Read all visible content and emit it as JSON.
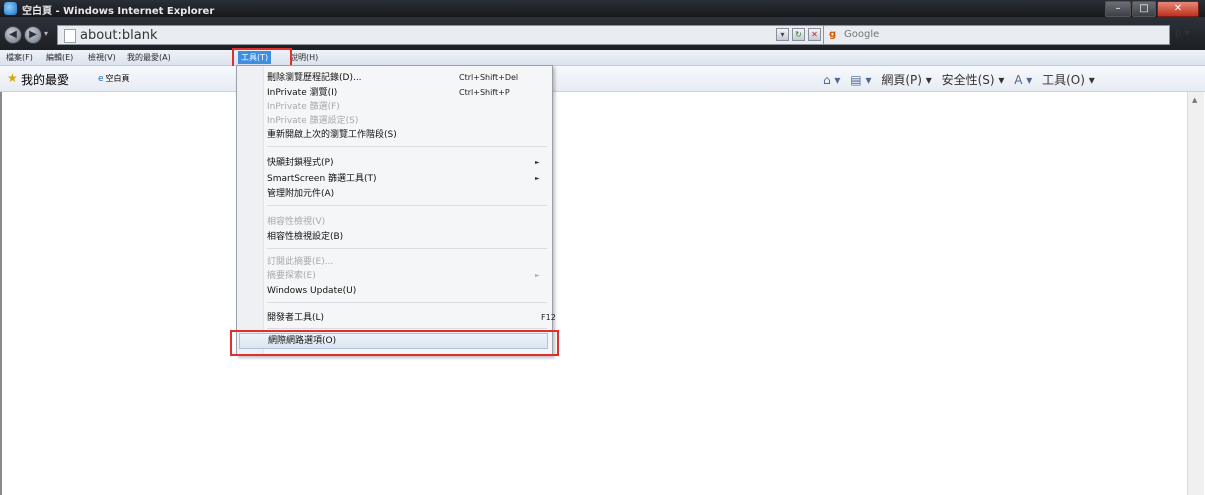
{
  "window": {
    "title": "空白頁 - Windows Internet Explorer",
    "controls": {
      "minimize": "–",
      "maximize": "□",
      "close": "✕"
    }
  },
  "navigation": {
    "back_icon": "back-arrow-icon",
    "forward_icon": "forward-arrow-icon",
    "dropdown": "▾"
  },
  "address": {
    "url": "about:blank",
    "dropdown": "▾",
    "refresh": "↻",
    "stop": "✕"
  },
  "search": {
    "provider_icon": "google-icon",
    "provider_glyph": "g",
    "placeholder": "Google",
    "go": "ρ ▾"
  },
  "menubar": {
    "items": [
      {
        "label": "檔案(F)"
      },
      {
        "label": "編輯(E)"
      },
      {
        "label": "檢視(V)"
      },
      {
        "label": "我的最愛(A)"
      },
      {
        "label": "工具(T)",
        "active": true
      },
      {
        "label": "說明(H)"
      }
    ]
  },
  "favorites": {
    "label": "我的最愛",
    "tab": "空白頁"
  },
  "command_bar": {
    "home": "⌂ ▾",
    "feeds": "▤ ▾",
    "page": "網頁(P) ▾",
    "safety": "安全性(S) ▾",
    "text_size": "A ▾",
    "tools": "工具(O) ▾"
  },
  "tools_menu": {
    "items": [
      {
        "label": "刪除瀏覽歷程記錄(D)...",
        "shortcut": "Ctrl+Shift+Del"
      },
      {
        "label": "InPrivate 瀏覽(I)",
        "shortcut": "Ctrl+Shift+P"
      },
      {
        "label": "InPrivate 篩選(F)",
        "disabled": true
      },
      {
        "label": "InPrivate 篩選設定(S)",
        "disabled": true
      },
      {
        "label": "重新開啟上次的瀏覽工作階段(S)"
      },
      {
        "separator": true
      },
      {
        "label": "快顯封鎖程式(P)",
        "submenu": true
      },
      {
        "label": "SmartScreen 篩選工具(T)",
        "submenu": true
      },
      {
        "label": "管理附加元件(A)"
      },
      {
        "separator": true
      },
      {
        "label": "相容性檢視(V)",
        "disabled": true
      },
      {
        "label": "相容性檢視設定(B)"
      },
      {
        "separator": true
      },
      {
        "label": "訂閱此摘要(E)...",
        "disabled": true
      },
      {
        "label": "摘要探索(E)",
        "disabled": true,
        "submenu": true
      },
      {
        "label": "Windows Update(U)"
      },
      {
        "separator": true
      },
      {
        "label": "開發者工具(L)",
        "shortcut": "F12"
      },
      {
        "separator": true
      },
      {
        "label": "網際網路選項(O)",
        "highlighted": true
      }
    ],
    "submenu_arrow": "►"
  },
  "scrollbar": {
    "up_arrow": "▲"
  },
  "colors": {
    "highlight_box": "#e12f2f",
    "active_menu": "#3d8ee0"
  }
}
